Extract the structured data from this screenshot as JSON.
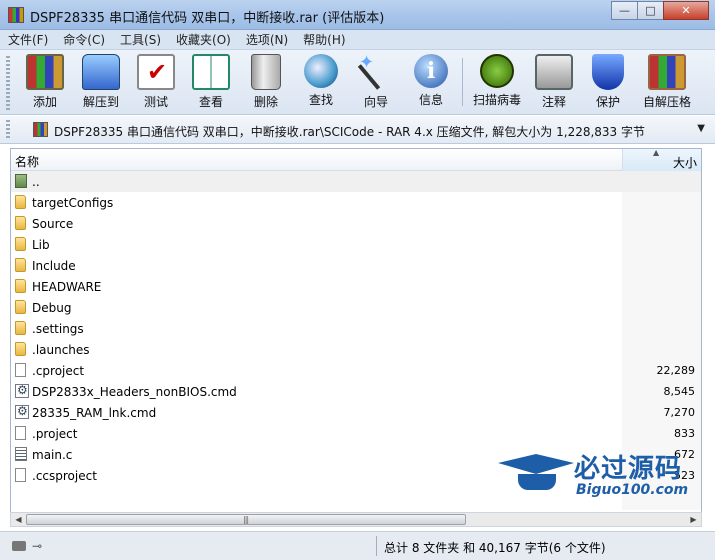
{
  "window": {
    "title": "DSPF28335 串口通信代码 双串口，中断接收.rar (评估版本)"
  },
  "window_buttons": {
    "minimize": "—",
    "maximize": "□",
    "close": "✕"
  },
  "menu": [
    "文件(F)",
    "命令(C)",
    "工具(S)",
    "收藏夹(O)",
    "选项(N)",
    "帮助(H)"
  ],
  "toolbar": [
    {
      "label": "添加",
      "icon": "add-archive-icon"
    },
    {
      "label": "解压到",
      "icon": "extract-icon"
    },
    {
      "label": "测试",
      "icon": "test-icon"
    },
    {
      "label": "查看",
      "icon": "view-book-icon"
    },
    {
      "label": "删除",
      "icon": "trash-icon"
    },
    {
      "label": "查找",
      "icon": "magnifier-icon"
    },
    {
      "label": "向导",
      "icon": "wizard-wand-icon"
    },
    {
      "label": "信息",
      "icon": "info-icon"
    },
    {
      "label": "扫描病毒",
      "icon": "virus-scan-icon"
    },
    {
      "label": "注释",
      "icon": "comment-icon"
    },
    {
      "label": "保护",
      "icon": "shield-icon"
    },
    {
      "label": "自解压格",
      "icon": "sfx-icon"
    }
  ],
  "address": {
    "text": "DSPF28335 串口通信代码 双串口，中断接收.rar\\SCICode - RAR 4.x 压缩文件, 解包大小为 1,228,833 字节"
  },
  "columns": {
    "name": "名称",
    "size": "大小"
  },
  "files": [
    {
      "name": "..",
      "size": "",
      "type": "up"
    },
    {
      "name": "targetConfigs",
      "size": "",
      "type": "folder"
    },
    {
      "name": "Source",
      "size": "",
      "type": "folder"
    },
    {
      "name": "Lib",
      "size": "",
      "type": "folder"
    },
    {
      "name": "Include",
      "size": "",
      "type": "folder"
    },
    {
      "name": "HEADWARE",
      "size": "",
      "type": "folder"
    },
    {
      "name": "Debug",
      "size": "",
      "type": "folder"
    },
    {
      "name": ".settings",
      "size": "",
      "type": "folder"
    },
    {
      "name": ".launches",
      "size": "",
      "type": "folder"
    },
    {
      "name": ".cproject",
      "size": "22,289",
      "type": "file"
    },
    {
      "name": "DSP2833x_Headers_nonBIOS.cmd",
      "size": "8,545",
      "type": "cmd"
    },
    {
      "name": "28335_RAM_lnk.cmd",
      "size": "7,270",
      "type": "cmd"
    },
    {
      "name": ".project",
      "size": "833",
      "type": "file"
    },
    {
      "name": "main.c",
      "size": "672",
      "type": "c"
    },
    {
      "name": ".ccsproject",
      "size": "523",
      "type": "file"
    }
  ],
  "status": {
    "summary": "总计 8 文件夹 和 40,167 字节(6 个文件)"
  },
  "watermark": {
    "cn": "必过源码",
    "en": "Biguo100.com"
  },
  "colors": {
    "title_bar": "#a9c5ea",
    "folder": "#e9b740",
    "watermark": "#1e5ea8"
  }
}
